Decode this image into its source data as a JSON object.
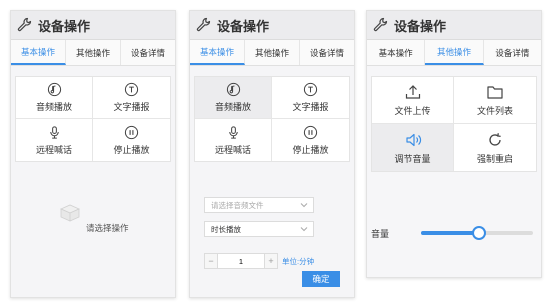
{
  "colors": {
    "accent": "#3a8ee6",
    "panel_bg": "#f5f5f7",
    "header_bg": "#ececee"
  },
  "panel_title": "设备操作",
  "tabs": [
    "基本操作",
    "其他操作",
    "设备详情"
  ],
  "basic_ops": [
    {
      "label": "音频播放",
      "icon": "audio-play-icon"
    },
    {
      "label": "文字播报",
      "icon": "text-broadcast-icon"
    },
    {
      "label": "远程喊话",
      "icon": "microphone-icon"
    },
    {
      "label": "停止播放",
      "icon": "pause-icon"
    }
  ],
  "other_ops": [
    {
      "label": "文件上传",
      "icon": "upload-icon"
    },
    {
      "label": "文件列表",
      "icon": "folder-icon"
    },
    {
      "label": "调节音量",
      "icon": "volume-icon"
    },
    {
      "label": "强制重启",
      "icon": "restart-icon"
    }
  ],
  "empty_state": {
    "text": "请选择操作",
    "icon": "empty-box-icon"
  },
  "audio_form": {
    "file_placeholder": "请选择音频文件",
    "duration_mode": "时长播放",
    "duration_value": "1",
    "unit_label": "单位:分钟",
    "confirm_label": "确定"
  },
  "volume": {
    "label": "音量",
    "level_percent": 52
  }
}
